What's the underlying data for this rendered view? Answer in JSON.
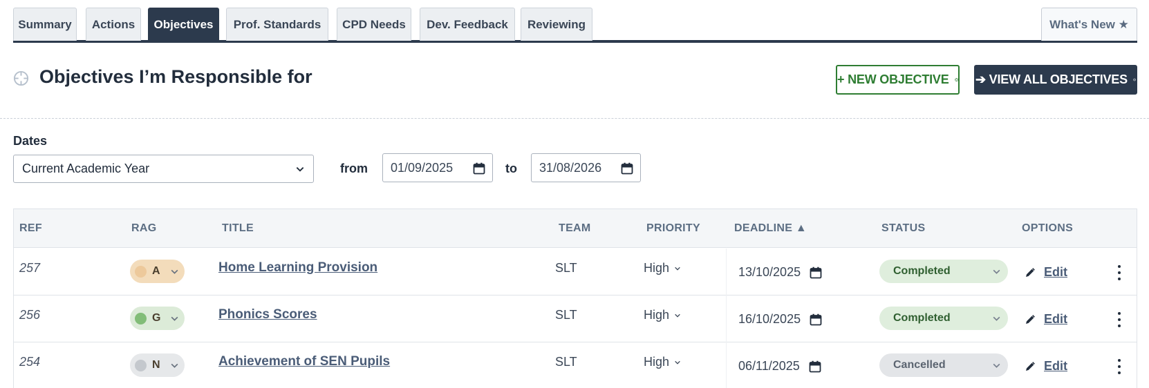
{
  "tabs": [
    {
      "label": "Summary"
    },
    {
      "label": "Actions"
    },
    {
      "label": "Objectives",
      "active": true
    },
    {
      "label": "Prof. Standards"
    },
    {
      "label": "CPD Needs"
    },
    {
      "label": "Dev. Feedback"
    },
    {
      "label": "Reviewing"
    }
  ],
  "whats_new": "What's New ★",
  "header": {
    "title": "Objectives I’m Responsible for",
    "new_objective": "+ NEW OBJECTIVE",
    "view_all": "➔ VIEW ALL OBJECTIVES",
    "icon": "crosshair-icon"
  },
  "filters": {
    "dates_label": "Dates",
    "range_selected": "Current Academic Year",
    "from_label": "from",
    "from_value": "01/09/2025",
    "to_label": "to",
    "to_value": "31/08/2026"
  },
  "table": {
    "columns": [
      "REF",
      "RAG",
      "TITLE",
      "TEAM",
      "PRIORITY",
      "DEADLINE ▲",
      "STATUS",
      "OPTIONS"
    ],
    "rows": [
      {
        "ref": "257",
        "rag": "A",
        "rag_dot": "#edc99b",
        "rag_bg": "#f3dcbb",
        "title": "Home Learning Provision",
        "team": "SLT",
        "priority": "High",
        "deadline": "13/10/2025",
        "status": "Completed",
        "status_kind": "completed",
        "edit": "Edit"
      },
      {
        "ref": "256",
        "rag": "G",
        "rag_dot": "#82bd78",
        "rag_bg": "#dcebd8",
        "title": "Phonics Scores",
        "team": "SLT",
        "priority": "High",
        "deadline": "16/10/2025",
        "status": "Completed",
        "status_kind": "completed",
        "edit": "Edit"
      },
      {
        "ref": "254",
        "rag": "N",
        "rag_dot": "#c4c8cd",
        "rag_bg": "#e6e8ea",
        "title": "Achievement of SEN Pupils",
        "team": "SLT",
        "priority": "High",
        "deadline": "06/11/2025",
        "status": "Cancelled",
        "status_kind": "cancelled",
        "edit": "Edit"
      }
    ]
  },
  "colors": {
    "primary": "#2c3a4d",
    "success": "#2e7d32"
  }
}
